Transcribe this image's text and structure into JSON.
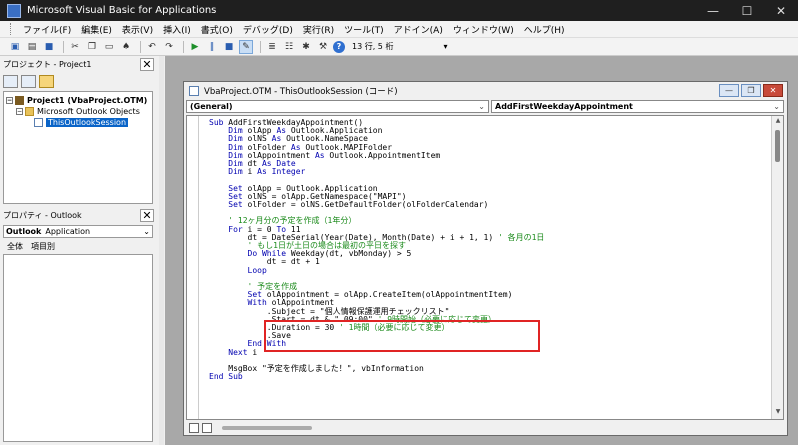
{
  "window": {
    "title": "Microsoft Visual Basic for Applications",
    "controls": [
      "—",
      "☐",
      "✕"
    ]
  },
  "menu": [
    "ファイル(F)",
    "編集(E)",
    "表示(V)",
    "挿入(I)",
    "書式(O)",
    "デバッグ(D)",
    "実行(R)",
    "ツール(T)",
    "アドイン(A)",
    "ウィンドウ(W)",
    "ヘルプ(H)"
  ],
  "toolbar": {
    "cursor_position": "13 行, 5 桁",
    "help_icon": "?"
  },
  "project_pane": {
    "title": "プロジェクト - Project1",
    "close": "✕",
    "tree": {
      "project": "Project1 (VbaProject.OTM)",
      "folder": "Microsoft Outlook Objects",
      "module": "ThisOutlookSession"
    }
  },
  "properties_pane": {
    "title": "プロパティ - Outlook",
    "close": "✕",
    "object_name": "Outlook",
    "object_type": "Application",
    "tabs": [
      "全体",
      "項目別"
    ]
  },
  "code_window": {
    "title": "VbaProject.OTM - ThisOutlookSession (コード)",
    "object_combo": "(General)",
    "procedure_combo": "AddFirstWeekdayAppointment",
    "buttons": [
      "—",
      "❐",
      "✕"
    ]
  },
  "code_lines": [
    [
      [
        "kw",
        "Sub "
      ],
      [
        "st",
        "AddFirstWeekdayAppointment()"
      ]
    ],
    [
      [
        "kw",
        "    Dim "
      ],
      [
        "st",
        "olApp "
      ],
      [
        "kw",
        "As "
      ],
      [
        "st",
        "Outlook.Application"
      ]
    ],
    [
      [
        "kw",
        "    Dim "
      ],
      [
        "st",
        "olNS "
      ],
      [
        "kw",
        "As "
      ],
      [
        "st",
        "Outlook.NameSpace"
      ]
    ],
    [
      [
        "kw",
        "    Dim "
      ],
      [
        "st",
        "olFolder "
      ],
      [
        "kw",
        "As "
      ],
      [
        "st",
        "Outlook.MAPIFolder"
      ]
    ],
    [
      [
        "kw",
        "    Dim "
      ],
      [
        "st",
        "olAppointment "
      ],
      [
        "kw",
        "As "
      ],
      [
        "st",
        "Outlook.AppointmentItem"
      ]
    ],
    [
      [
        "kw",
        "    Dim "
      ],
      [
        "st",
        "dt "
      ],
      [
        "kw",
        "As Date"
      ]
    ],
    [
      [
        "kw",
        "    Dim "
      ],
      [
        "st",
        "i "
      ],
      [
        "kw",
        "As Integer"
      ]
    ],
    [
      [
        "st",
        ""
      ]
    ],
    [
      [
        "kw",
        "    Set "
      ],
      [
        "st",
        "olApp = Outlook.Application"
      ]
    ],
    [
      [
        "kw",
        "    Set "
      ],
      [
        "st",
        "olNS = olApp.GetNamespace(\"MAPI\")"
      ]
    ],
    [
      [
        "kw",
        "    Set "
      ],
      [
        "st",
        "olFolder = olNS.GetDefaultFolder(olFolderCalendar)"
      ]
    ],
    [
      [
        "st",
        ""
      ]
    ],
    [
      [
        "cm",
        "    ' 12ヶ月分の予定を作成（1年分）"
      ]
    ],
    [
      [
        "kw",
        "    For "
      ],
      [
        "st",
        "i = 0 "
      ],
      [
        "kw",
        "To "
      ],
      [
        "st",
        "11"
      ]
    ],
    [
      [
        "st",
        "        dt = DateSerial(Year(Date), Month(Date) + i + 1, 1) "
      ],
      [
        "cm",
        "' 各月の1日"
      ]
    ],
    [
      [
        "cm",
        "        ' もし1日が土日の場合は最初の平日を探す"
      ]
    ],
    [
      [
        "kw",
        "        Do While "
      ],
      [
        "st",
        "Weekday(dt, vbMonday) > 5"
      ]
    ],
    [
      [
        "st",
        "            dt = dt + 1"
      ]
    ],
    [
      [
        "kw",
        "        Loop"
      ]
    ],
    [
      [
        "st",
        ""
      ]
    ],
    [
      [
        "cm",
        "        ' 予定を作成"
      ]
    ],
    [
      [
        "kw",
        "        Set "
      ],
      [
        "st",
        "olAppointment = olApp.CreateItem(olAppointmentItem)"
      ]
    ],
    [
      [
        "kw",
        "        With "
      ],
      [
        "st",
        "olAppointment"
      ]
    ],
    [
      [
        "st",
        "            .Subject = \"個人情報保護運用チェックリスト\""
      ]
    ],
    [
      [
        "st",
        "            .Start = dt & \" 09:00\" "
      ],
      [
        "cm",
        "' 9時開始（必要に応じて変更）"
      ]
    ],
    [
      [
        "st",
        "            .Duration = 30 "
      ],
      [
        "cm",
        "' 1時間（必要に応じて変更）"
      ]
    ],
    [
      [
        "st",
        "            .Save"
      ]
    ],
    [
      [
        "kw",
        "        End With"
      ]
    ],
    [
      [
        "kw",
        "    Next "
      ],
      [
        "st",
        "i"
      ]
    ],
    [
      [
        "st",
        ""
      ]
    ],
    [
      [
        "st",
        "    MsgBox \"予定を作成しました！\", vbInformation"
      ]
    ],
    [
      [
        "kw",
        "End Sub"
      ]
    ]
  ],
  "colors": {
    "keyword": "#0000b0",
    "comment": "#1a8a1a",
    "highlight_box": "#e02424",
    "selection": "#0a64c8"
  }
}
